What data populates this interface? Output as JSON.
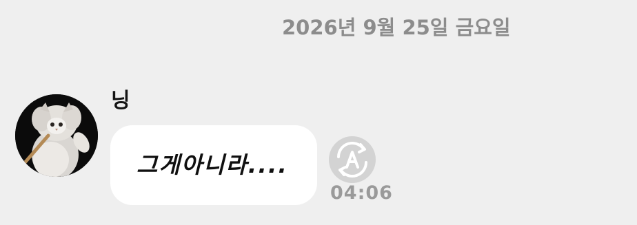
{
  "date_header": "2026년 9월 25일 금요일",
  "sender": {
    "name": "닝",
    "avatar_icon": "white-cat-avatar"
  },
  "message": {
    "text": "그게아니라....",
    "time": "04:06"
  },
  "translate_button": {
    "icon": "translate-icon",
    "glyph": "A"
  },
  "colors": {
    "background": "#efefef",
    "bubble": "#ffffff",
    "date_text": "#8c8c8c",
    "timestamp_text": "#9a9a9a",
    "translate_button_bg": "#d3d3d3"
  }
}
